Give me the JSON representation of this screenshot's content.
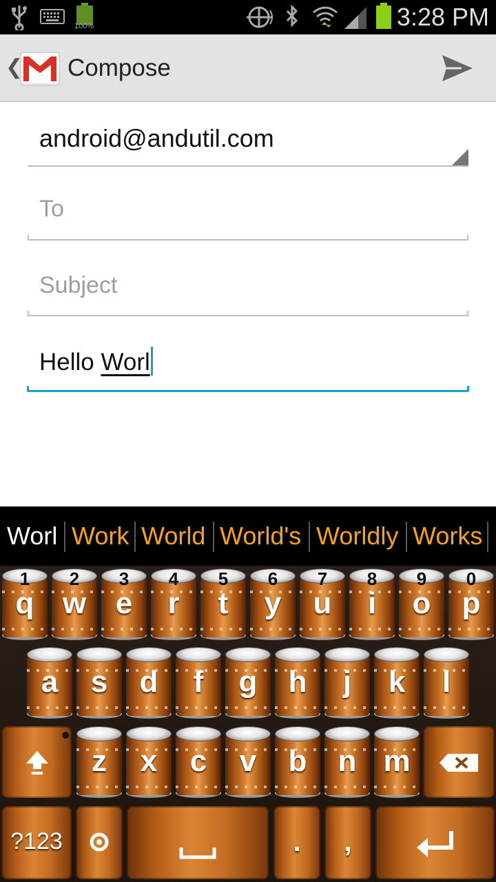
{
  "status_bar": {
    "time": "3:28 PM",
    "battery_small_label": "100%",
    "icons": [
      "usb-icon",
      "keyboard-icon",
      "battery-small-icon",
      "sync-icon",
      "bluetooth-icon",
      "wifi-icon",
      "signal-icon",
      "battery-icon"
    ],
    "battery_color": "#8ccf1b"
  },
  "action_bar": {
    "title": "Compose",
    "icons": [
      "back-chevron-icon",
      "gmail-logo-icon",
      "send-icon"
    ]
  },
  "compose": {
    "from": "android@andutil.com",
    "to_placeholder": "To",
    "subject_placeholder": "Subject",
    "body_prefix": "Hello ",
    "body_composing": "Worl"
  },
  "suggestions": [
    "Worl",
    "Work",
    "World",
    "World's",
    "Worldly",
    "Works"
  ],
  "keyboard": {
    "row1": [
      {
        "letter": "q",
        "num": "1"
      },
      {
        "letter": "w",
        "num": "2"
      },
      {
        "letter": "e",
        "num": "3"
      },
      {
        "letter": "r",
        "num": "4"
      },
      {
        "letter": "t",
        "num": "5"
      },
      {
        "letter": "y",
        "num": "6"
      },
      {
        "letter": "u",
        "num": "7"
      },
      {
        "letter": "i",
        "num": "8"
      },
      {
        "letter": "o",
        "num": "9"
      },
      {
        "letter": "p",
        "num": "0"
      }
    ],
    "row2": [
      "a",
      "s",
      "d",
      "f",
      "g",
      "h",
      "j",
      "k",
      "l"
    ],
    "row3": [
      "z",
      "x",
      "c",
      "v",
      "b",
      "n",
      "m"
    ],
    "symbols_label": "?123",
    "period_label": ".",
    "comma_label": ",",
    "function_icons": [
      "shift-icon",
      "backspace-icon",
      "settings-icon",
      "space-icon",
      "enter-icon"
    ]
  },
  "colors": {
    "accent": "#1a9fd1",
    "suggestion": "#f7a21b",
    "status_bar": "#000000",
    "action_bar": "#e3e3e3"
  }
}
